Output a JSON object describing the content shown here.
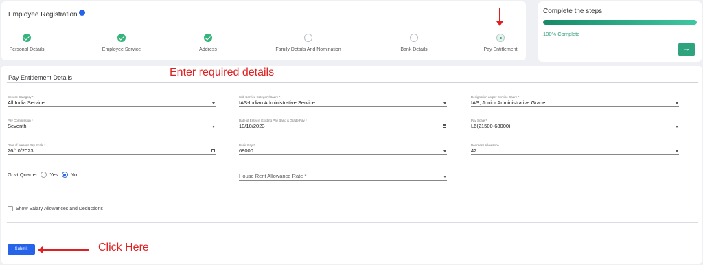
{
  "stepper": {
    "title": "Employee Registration",
    "info_icon": "info-icon",
    "steps": [
      {
        "label": "Personal Details",
        "status": "done"
      },
      {
        "label": "Employee Service",
        "status": "done"
      },
      {
        "label": "Address",
        "status": "done"
      },
      {
        "label": "Family Details And Nomination",
        "status": "todo"
      },
      {
        "label": "Bank Details",
        "status": "todo"
      },
      {
        "label": "Pay Entitlement",
        "status": "current"
      }
    ]
  },
  "progress": {
    "title": "Complete the steps",
    "percent": 100,
    "text": "100% Complete",
    "next_icon": "arrow-right-icon"
  },
  "form": {
    "section_title": "Pay Entitlement Details",
    "fields": {
      "service_category": {
        "label": "Service Category *",
        "value": "All India Service",
        "control": "select"
      },
      "sub_service_category": {
        "label": "Sub Service Category/Cadre *",
        "value": "IAS-Indian Administrative Service",
        "control": "select"
      },
      "designation": {
        "label": "Designation as per Service Cadre *",
        "value": "IAS, Junior Administrative Grade",
        "control": "select"
      },
      "pay_commission": {
        "label": "Pay Commission *",
        "value": "Seventh",
        "control": "select"
      },
      "date_of_entry": {
        "label": "Date of Entry in Existing Pay Band & Grade Pay *",
        "value": "10/10/2023",
        "control": "date"
      },
      "pay_scale": {
        "label": "Pay Scale *",
        "value": "L6(21500-68000)",
        "control": "select"
      },
      "date_present_pay_scale": {
        "label": "Date of present Pay Scale *",
        "value": "26/10/2023",
        "control": "date"
      },
      "basic_pay": {
        "label": "Basic Pay *",
        "value": "68000",
        "control": "select"
      },
      "dearness_allowance": {
        "label": "Dearness Allowance",
        "value": "42",
        "control": "select"
      },
      "hra_rate": {
        "label": "",
        "placeholder": "House Rent Allowance Rate *",
        "control": "select"
      }
    },
    "govt_quarter": {
      "label": "Govt Quarter",
      "options": [
        "Yes",
        "No"
      ],
      "selected": "No"
    },
    "show_salary_checkbox": {
      "label": "Show Salary Allowances and Deductions",
      "checked": false
    },
    "submit_label": "Submit"
  },
  "annotations": {
    "enter_details": "Enter required details",
    "click_here": "Click Here",
    "accent_red": "#e02020"
  },
  "colors": {
    "brand_green": "#2ea37d",
    "primary_blue": "#2563eb"
  }
}
